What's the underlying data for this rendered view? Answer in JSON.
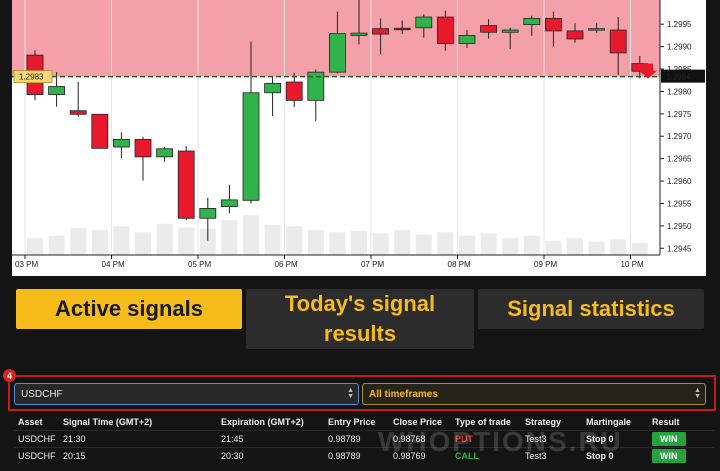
{
  "chart_data": {
    "type": "candlestick",
    "x_ticks": [
      "03 PM",
      "04 PM",
      "05 PM",
      "06 PM",
      "07 PM",
      "08 PM",
      "09 PM",
      "10 PM"
    ],
    "y_ticks": [
      1.2945,
      1.295,
      1.2955,
      1.296,
      1.2965,
      1.297,
      1.2975,
      1.298,
      1.2985,
      1.299,
      1.2995
    ],
    "ylim": [
      1.29435,
      1.30004
    ],
    "current_price_label": "1.2984",
    "entry_price_label": "1.2983",
    "entry_level": 1.29833,
    "candles": [
      {
        "o": 1.29881,
        "h": 1.29892,
        "l": 1.2978,
        "c": 1.29793
      },
      {
        "o": 1.29793,
        "h": 1.29843,
        "l": 1.29766,
        "c": 1.29811
      },
      {
        "o": 1.29757,
        "h": 1.29821,
        "l": 1.29743,
        "c": 1.29749
      },
      {
        "o": 1.29749,
        "h": 1.29749,
        "l": 1.29673,
        "c": 1.29673
      },
      {
        "o": 1.29676,
        "h": 1.29709,
        "l": 1.29651,
        "c": 1.29693
      },
      {
        "o": 1.29693,
        "h": 1.29698,
        "l": 1.29601,
        "c": 1.29654
      },
      {
        "o": 1.29654,
        "h": 1.29676,
        "l": 1.29643,
        "c": 1.29672
      },
      {
        "o": 1.29667,
        "h": 1.29678,
        "l": 1.29513,
        "c": 1.29517
      },
      {
        "o": 1.29517,
        "h": 1.29563,
        "l": 1.29467,
        "c": 1.29539
      },
      {
        "o": 1.29543,
        "h": 1.29592,
        "l": 1.29528,
        "c": 1.29558
      },
      {
        "o": 1.29557,
        "h": 1.29911,
        "l": 1.2955,
        "c": 1.29797
      },
      {
        "o": 1.29797,
        "h": 1.29833,
        "l": 1.29745,
        "c": 1.29818
      },
      {
        "o": 1.29821,
        "h": 1.29841,
        "l": 1.29765,
        "c": 1.2978
      },
      {
        "o": 1.2978,
        "h": 1.29849,
        "l": 1.29734,
        "c": 1.29843
      },
      {
        "o": 1.29843,
        "h": 1.29978,
        "l": 1.2984,
        "c": 1.29929
      },
      {
        "o": 1.29925,
        "h": 1.30015,
        "l": 1.29905,
        "c": 1.2993
      },
      {
        "o": 1.2994,
        "h": 1.29963,
        "l": 1.29883,
        "c": 1.29928
      },
      {
        "o": 1.29941,
        "h": 1.29958,
        "l": 1.29928,
        "c": 1.2994
      },
      {
        "o": 1.29942,
        "h": 1.29972,
        "l": 1.2992,
        "c": 1.29966
      },
      {
        "o": 1.29966,
        "h": 1.2998,
        "l": 1.29891,
        "c": 1.29907
      },
      {
        "o": 1.29907,
        "h": 1.29937,
        "l": 1.29897,
        "c": 1.29925
      },
      {
        "o": 1.29947,
        "h": 1.29961,
        "l": 1.29918,
        "c": 1.29932
      },
      {
        "o": 1.29932,
        "h": 1.29942,
        "l": 1.29895,
        "c": 1.29937
      },
      {
        "o": 1.29949,
        "h": 1.29969,
        "l": 1.29924,
        "c": 1.29963
      },
      {
        "o": 1.29963,
        "h": 1.29978,
        "l": 1.299,
        "c": 1.29935
      },
      {
        "o": 1.29935,
        "h": 1.29952,
        "l": 1.29909,
        "c": 1.29917
      },
      {
        "o": 1.29937,
        "h": 1.29952,
        "l": 1.2993,
        "c": 1.2994
      },
      {
        "o": 1.29937,
        "h": 1.29966,
        "l": 1.29837,
        "c": 1.29886
      },
      {
        "o": 1.29862,
        "h": 1.29879,
        "l": 1.29829,
        "c": 1.29845
      }
    ],
    "volumes": [
      0.28,
      0.32,
      0.45,
      0.42,
      0.48,
      0.38,
      0.52,
      0.46,
      0.44,
      0.58,
      0.66,
      0.5,
      0.48,
      0.42,
      0.38,
      0.4,
      0.36,
      0.42,
      0.34,
      0.38,
      0.32,
      0.36,
      0.28,
      0.32,
      0.24,
      0.28,
      0.22,
      0.26,
      0.2
    ],
    "colors": {
      "up": "#2fb34a",
      "down": "#e8192c",
      "zone": "#f4a0a8",
      "grid": "#e6e6e6",
      "volume": "#ebebeb",
      "label_bg": "#f7d774",
      "current_bg": "#111111",
      "arrow": "#e8192c"
    }
  },
  "tabs": {
    "active": "Active signals",
    "today": "Today's signal results",
    "stats": "Signal statistics"
  },
  "step_badge": "4",
  "filters": {
    "asset": "USDCHF",
    "timeframe": "All timeframes"
  },
  "table": {
    "headers": [
      "Asset",
      "Signal Time (GMT+2)",
      "Expiration (GMT+2)",
      "Entry Price",
      "Close Price",
      "Type of trade",
      "Strategy",
      "Martingale",
      "Result"
    ],
    "rows": [
      {
        "asset": "USDCHF",
        "signal_time": "21:30",
        "expiration": "21:45",
        "entry": "0.98789",
        "close": "0.98768",
        "type": "PUT",
        "strategy": "Test3",
        "martingale": "Stop 0",
        "result": "WIN"
      },
      {
        "asset": "USDCHF",
        "signal_time": "20:15",
        "expiration": "20:30",
        "entry": "0.98789",
        "close": "0.98769",
        "type": "CALL",
        "strategy": "Test3",
        "martingale": "Stop 0",
        "result": "WIN"
      }
    ]
  },
  "watermark": "WHOPTIONS.RU"
}
